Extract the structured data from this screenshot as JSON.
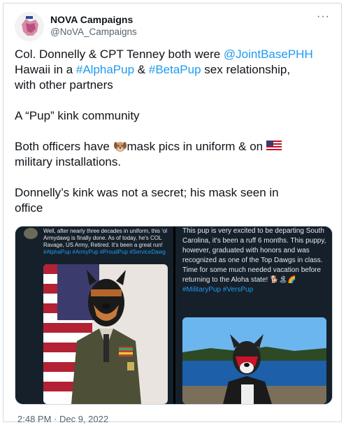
{
  "author": {
    "name": "NOVA Campaigns",
    "handle": "@NoVA_Campaigns"
  },
  "menu": {
    "more_label": "···"
  },
  "tweet": {
    "line1_pre": "Col. Donnelly & CPT Tenney both were ",
    "mention": "@JointBasePHH",
    "line2_pre": "Hawaii in a ",
    "tag1": "#AlphaPup",
    "amp": " & ",
    "tag2": "#BetaPup",
    "line2_post": " sex relationship,",
    "line3": "with other partners",
    "para2": "A “Pup” kink community",
    "para3_pre": "Both officers have ",
    "para3_mid": "mask pics in uniform & on ",
    "para3_post": "military installations.",
    "para4_a": "Donnelly’s kink was not a secret; his mask seen in",
    "para4_b": "office"
  },
  "media": {
    "left_caption": "Well, after nearly three decades in uniform, this 'ol Armydawg is finally done. As of today, he's COL Ravage, US Army, Retired. It's been a great run!",
    "left_tags": "#AlphaPup #ArmyPup #ProudPup #ServiceDawg",
    "right_caption": "This pup is very excited to be departing South Carolina, it's been a ruff 6 months. This puppy, however, graduated with honors and was recognized as one of the Top Dawgs in class. Time for some much needed vacation before returning to the Aloha state! 🐕🏝🌈",
    "right_tags": "#MilitaryPup #VersPup"
  },
  "timestamp": "2:48 PM · Dec 9, 2022",
  "colors": {
    "link": "#1d9bf0",
    "text": "#0f1419",
    "muted": "#536471"
  },
  "icons": [
    "more-icon",
    "dog-face-emoji-icon",
    "us-flag-emoji-icon"
  ]
}
